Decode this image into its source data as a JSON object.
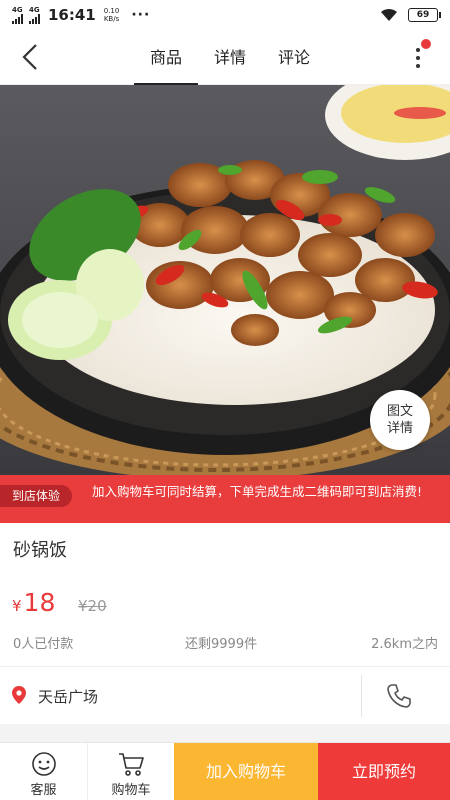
{
  "status": {
    "net1": "4G",
    "net2": "4G",
    "time": "16:41",
    "speed_value": "0.10",
    "speed_unit": "KB/s",
    "more": "···",
    "battery": "69"
  },
  "header": {
    "tabs": [
      {
        "label": "商品"
      },
      {
        "label": "详情"
      },
      {
        "label": "评论"
      }
    ]
  },
  "hero": {
    "detail_bubble": "图文详情"
  },
  "promo": {
    "tag": "到店体验",
    "text": "加入购物车可同时结算，下单完成生成二维码即可到店消费!"
  },
  "product": {
    "name": "砂锅饭",
    "currency": "¥",
    "price": "18",
    "original_price": "¥20",
    "sold": "0人已付款",
    "stock": "还剩9999件",
    "distance": "2.6km之内"
  },
  "store": {
    "name": "天岳广场"
  },
  "bottombar": {
    "service": "客服",
    "cart": "购物车",
    "add_to_cart": "加入购物车",
    "book_now": "立即预约"
  },
  "colors": {
    "brand_red": "#e93c3c",
    "cart_button": "#fbb632",
    "book_button": "#ef3a3a"
  }
}
